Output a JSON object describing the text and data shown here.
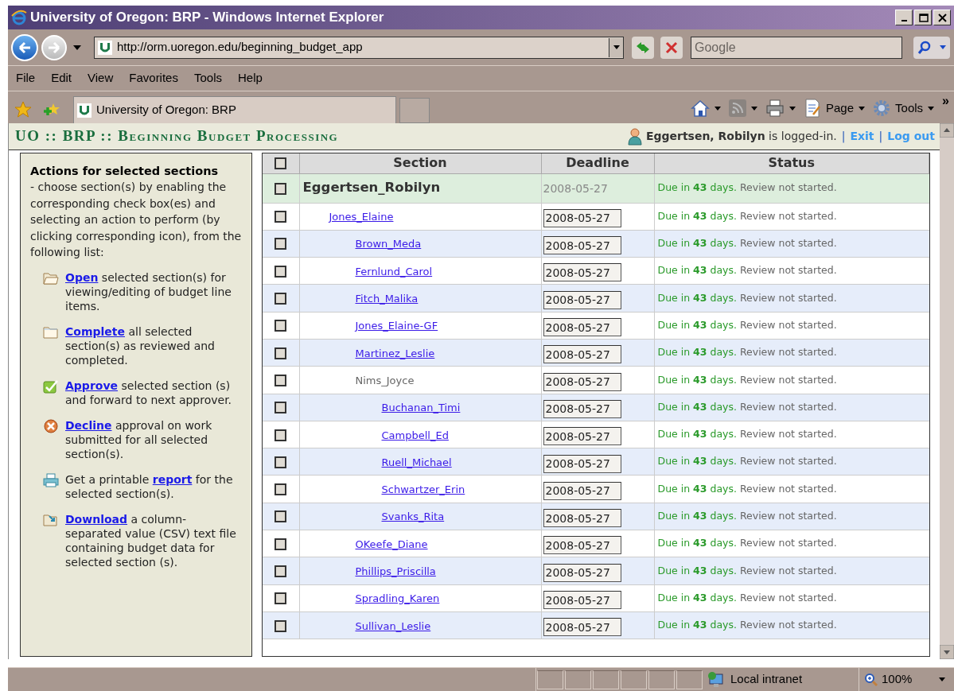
{
  "window": {
    "title": "University of Oregon: BRP - Windows Internet Explorer"
  },
  "address_bar": {
    "value": "http://orm.uoregon.edu/beginning_budget_app"
  },
  "search": {
    "placeholder": "Google"
  },
  "menu": [
    "File",
    "Edit",
    "View",
    "Favorites",
    "Tools",
    "Help"
  ],
  "tabs": [
    {
      "label": "University of Oregon: BRP",
      "selected": true
    }
  ],
  "command_bar": [
    {
      "kind": "home"
    },
    {
      "kind": "feeds"
    },
    {
      "kind": "print"
    },
    {
      "kind": "page",
      "label": "Page"
    },
    {
      "kind": "tools",
      "label": "Tools"
    }
  ],
  "chevron": "»",
  "header": {
    "title": "UO :: BRP :: Beginning Budget Processing",
    "user": "Eggertsen, Robilyn",
    "user_suffix": "is logged-in.",
    "separator": "|",
    "links": [
      "Exit",
      "Log out"
    ]
  },
  "panel": {
    "heading": "Actions for selected sections",
    "description": "- choose section(s) by enabling the corresponding check box(es) and selecting an action to perform (by clicking corresponding icon), from the following list:",
    "actions": [
      {
        "kind": "open",
        "link": "Open",
        "after": "selected section(s) for viewing/editing of budget line items."
      },
      {
        "kind": "complete",
        "link": "Complete",
        "after": "all selected section(s) as reviewed and completed."
      },
      {
        "kind": "approve",
        "link": "Approve",
        "after": "selected section (s) and forward to next approver."
      },
      {
        "kind": "decline",
        "link": "Decline",
        "after": "approval on work submitted for all selected section(s)."
      },
      {
        "kind": "report",
        "before": "Get a printable",
        "link": "report",
        "after": "for the selected section(s)."
      },
      {
        "kind": "download",
        "link": "Download",
        "after": "a column-separated value (CSV) text file containing budget data for selected section (s)."
      }
    ]
  },
  "table": {
    "columns": [
      "Section",
      "Deadline",
      "Status"
    ],
    "header_checked": false,
    "rows": [
      {
        "kind": "root",
        "name": "Eggertsen_Robilyn",
        "deadline": "2008-05-27",
        "due": "Due in **43** days.",
        "review": "Review not started.",
        "checked": false,
        "children": [
          {
            "kind": "link",
            "name": "Jones_Elaine",
            "deadline": "2008-05-27",
            "due": "Due in **43** days.",
            "review": "Review not started.",
            "checked": false,
            "children": [
              {
                "kind": "link",
                "name": "Brown_Meda",
                "deadline": "2008-05-27",
                "due": "Due in **43** days.",
                "review": "Review not started.",
                "checked": false
              },
              {
                "kind": "link",
                "name": "Fernlund_Carol",
                "deadline": "2008-05-27",
                "due": "Due in **43** days.",
                "review": "Review not started.",
                "checked": false
              },
              {
                "kind": "link",
                "name": "Fitch_Malika",
                "deadline": "2008-05-27",
                "due": "Due in **43** days.",
                "review": "Review not started.",
                "checked": false
              },
              {
                "kind": "link",
                "name": "Jones_Elaine-GF",
                "deadline": "2008-05-27",
                "due": "Due in **43** days.",
                "review": "Review not started.",
                "checked": false
              },
              {
                "kind": "link",
                "name": "Martinez_Leslie",
                "deadline": "2008-05-27",
                "due": "Due in **43** days.",
                "review": "Review not started.",
                "checked": false
              },
              {
                "kind": "plain",
                "name": "Nims_Joyce",
                "deadline": "2008-05-27",
                "due": "Due in **43** days.",
                "review": "Review not started.",
                "checked": false,
                "children": [
                  {
                    "kind": "link",
                    "name": "Buchanan_Timi",
                    "deadline": "2008-05-27",
                    "due": "Due in **43** days.",
                    "review": "Review not started.",
                    "checked": false
                  },
                  {
                    "kind": "link",
                    "name": "Campbell_Ed",
                    "deadline": "2008-05-27",
                    "due": "Due in **43** days.",
                    "review": "Review not started.",
                    "checked": false
                  },
                  {
                    "kind": "link",
                    "name": "Ruell_Michael",
                    "deadline": "2008-05-27",
                    "due": "Due in **43** days.",
                    "review": "Review not started.",
                    "checked": false
                  },
                  {
                    "kind": "link",
                    "name": "Schwartzer_Erin",
                    "deadline": "2008-05-27",
                    "due": "Due in **43** days.",
                    "review": "Review not started.",
                    "checked": false
                  },
                  {
                    "kind": "link",
                    "name": "Svanks_Rita",
                    "deadline": "2008-05-27",
                    "due": "Due in **43** days.",
                    "review": "Review not started.",
                    "checked": false
                  }
                ]
              },
              {
                "kind": "link",
                "name": "OKeefe_Diane",
                "deadline": "2008-05-27",
                "due": "Due in **43** days.",
                "review": "Review not started.",
                "checked": false
              },
              {
                "kind": "link",
                "name": "Phillips_Priscilla",
                "deadline": "2008-05-27",
                "due": "Due in **43** days.",
                "review": "Review not started.",
                "checked": false
              },
              {
                "kind": "link",
                "name": "Spradling_Karen",
                "deadline": "2008-05-27",
                "due": "Due in **43** days.",
                "review": "Review not started.",
                "checked": false
              },
              {
                "kind": "link",
                "name": "Sullivan_Leslie",
                "deadline": "2008-05-27",
                "due": "Due in **43** days.",
                "review": "Review not started.",
                "checked": false
              }
            ]
          }
        ]
      }
    ]
  },
  "status_bar": {
    "zone": "Local intranet",
    "zoom": "100%"
  }
}
